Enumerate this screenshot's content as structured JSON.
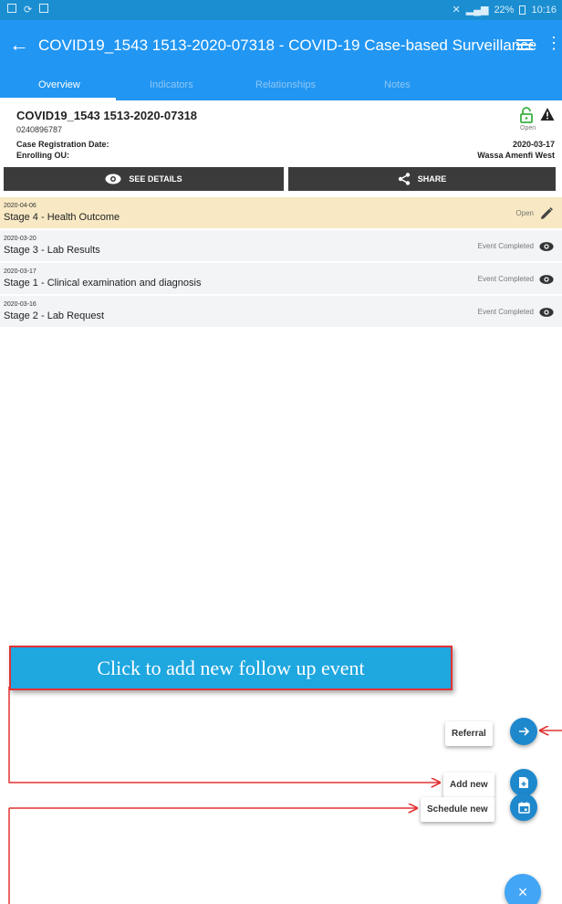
{
  "status_bar": {
    "battery": "22%",
    "time": "10:16"
  },
  "app_bar": {
    "title": "COVID19_1543 1513-2020-07318 - COVID-19 Case-based Surveillance",
    "back_icon": "arrow-left-icon",
    "filter_icon": "filter-icon",
    "more_icon": "more-vert-icon"
  },
  "tabs": [
    {
      "label": "Overview",
      "active": true
    },
    {
      "label": "Indicators",
      "active": false
    },
    {
      "label": "Relationships",
      "active": false
    },
    {
      "label": "Notes",
      "active": false
    }
  ],
  "case": {
    "id": "COVID19_1543 1513-2020-07318",
    "phone": "0240896787",
    "state": "Open",
    "registration_label": "Case Registration Date:",
    "registration_value": "2020-03-17",
    "enrolling_label": "Enrolling OU:",
    "enrolling_value": "Wassa Amenfi West"
  },
  "buttons": {
    "see_details": "SEE DETAILS",
    "share": "SHARE"
  },
  "events": [
    {
      "date": "2020-04-06",
      "name": "Stage 4 - Health Outcome",
      "status": "Open",
      "icon": "edit-icon"
    },
    {
      "date": "2020-03-20",
      "name": "Stage 3 - Lab Results",
      "status": "Event Completed",
      "icon": "eye-icon"
    },
    {
      "date": "2020-03-17",
      "name": "Stage 1 - Clinical examination and diagnosis",
      "status": "Event Completed",
      "icon": "eye-icon"
    },
    {
      "date": "2020-03-16",
      "name": "Stage 2 - Lab Request",
      "status": "Event Completed",
      "icon": "eye-icon"
    }
  ],
  "annotation": {
    "text": "Click to add new follow up event"
  },
  "fab_menu": {
    "referral": "Referral",
    "add_new": "Add new",
    "schedule_new": "Schedule new",
    "close_icon": "×"
  },
  "colors": {
    "primary": "#2196f3",
    "open_row": "#f8e9c4",
    "accent_red": "#e23333",
    "lock_green": "#3cb043"
  }
}
